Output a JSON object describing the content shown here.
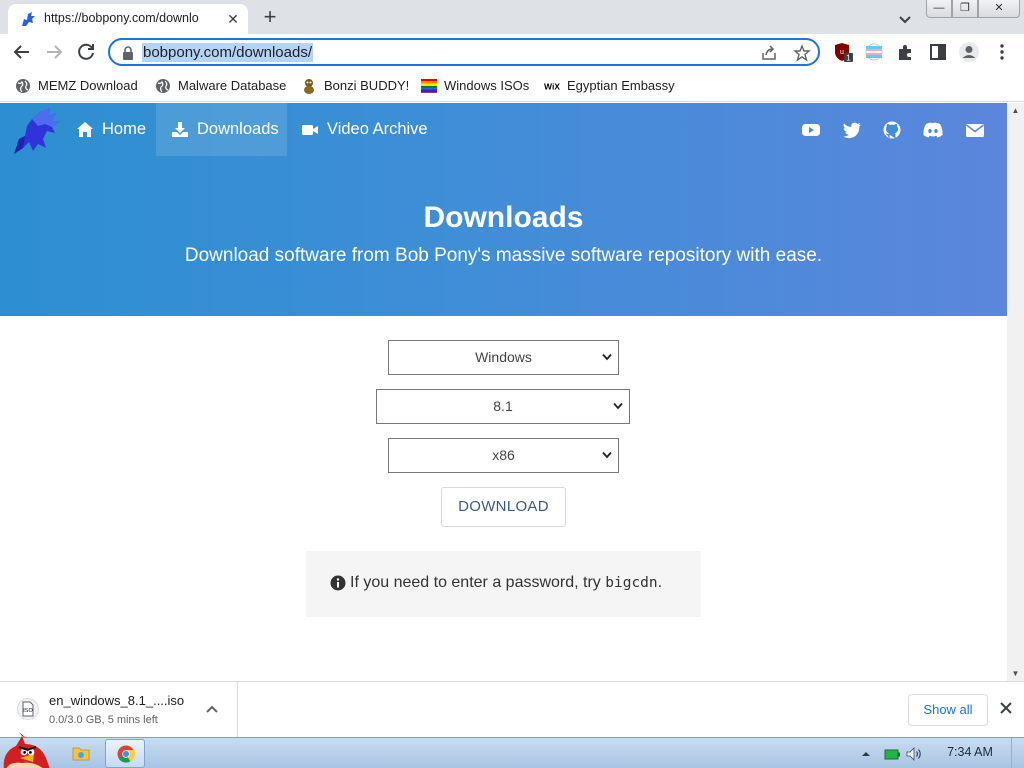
{
  "browser": {
    "tab": {
      "title": "https://bobpony.com/downlo",
      "close": "✕"
    },
    "new_tab": "+",
    "window_controls": {
      "minimize": "—",
      "maximize": "❐",
      "close": "✕"
    },
    "url": "bobpony.com/downloads/",
    "extension_badge": "1",
    "bookmarks": [
      {
        "label": "MEMZ Download",
        "icon": "globe-icon"
      },
      {
        "label": "Malware Database",
        "icon": "globe-icon"
      },
      {
        "label": "Bonzi BUDDY!",
        "icon": "bonzi-icon"
      },
      {
        "label": "Windows ISOs",
        "icon": "rainbow-flag-icon"
      },
      {
        "label": "Egyptian Embassy",
        "icon": "wix-icon"
      }
    ],
    "wix_text": "WiX"
  },
  "site": {
    "nav": [
      {
        "label": "Home",
        "icon": "home-icon"
      },
      {
        "label": "Downloads",
        "icon": "download-icon",
        "active": true
      },
      {
        "label": "Video Archive",
        "icon": "video-icon"
      }
    ],
    "social": [
      "youtube-icon",
      "twitter-icon",
      "github-icon",
      "discord-icon",
      "mail-icon"
    ],
    "hero": {
      "title": "Downloads",
      "subtitle": "Download software from Bob Pony's massive software repository with ease."
    },
    "selects": {
      "os": "Windows",
      "version": "8.1",
      "arch": "x86"
    },
    "download_button": "DOWNLOAD",
    "note": {
      "text": "If you need to enter a password, try ",
      "code": "bigcdn",
      "end": "."
    }
  },
  "download_shelf": {
    "file_name": "en_windows_8.1_....iso",
    "status": "0.0/3.0 GB, 5 mins left",
    "file_icon_text": "ISO",
    "show_all": "Show all"
  },
  "taskbar": {
    "clock": "7:34 AM"
  },
  "colors": {
    "hero_start": "#2d8fd0",
    "hero_end": "#5b86dc",
    "omnibox_focus": "#1a73e8",
    "url_selection": "#b4d4f7"
  }
}
